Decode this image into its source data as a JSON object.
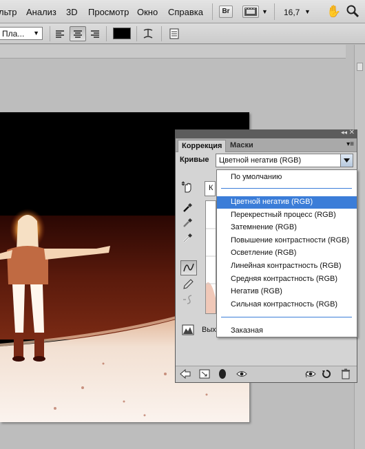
{
  "menubar": {
    "items": [
      "льтр",
      "Анализ",
      "3D",
      "Просмотр",
      "Окно",
      "Справка"
    ],
    "bridge_label": "Br",
    "zoom": "16,7"
  },
  "options": {
    "font_style": "Пла..."
  },
  "panel": {
    "tabs": [
      "Коррекция",
      "Маски"
    ],
    "section_label": "Кривые",
    "preset_value": "Цветной негатив (RGB)",
    "channel_partial": "К",
    "output_partial": "Вых"
  },
  "dropdown": {
    "items": [
      "По умолчанию",
      "Цветной негатив (RGB)",
      "Перекрестный процесс (RGB)",
      "Затемнение (RGB)",
      "Повышение контрастности (RGB)",
      "Осветление (RGB)",
      "Линейная контрастность (RGB)",
      "Средняя контрастность (RGB)",
      "Негатив (RGB)",
      "Сильная контрастность (RGB)",
      "Заказная"
    ],
    "selected_index": 1
  },
  "colors": {
    "accent": "#3b7dd8",
    "foreground_swatch": "#000000"
  }
}
